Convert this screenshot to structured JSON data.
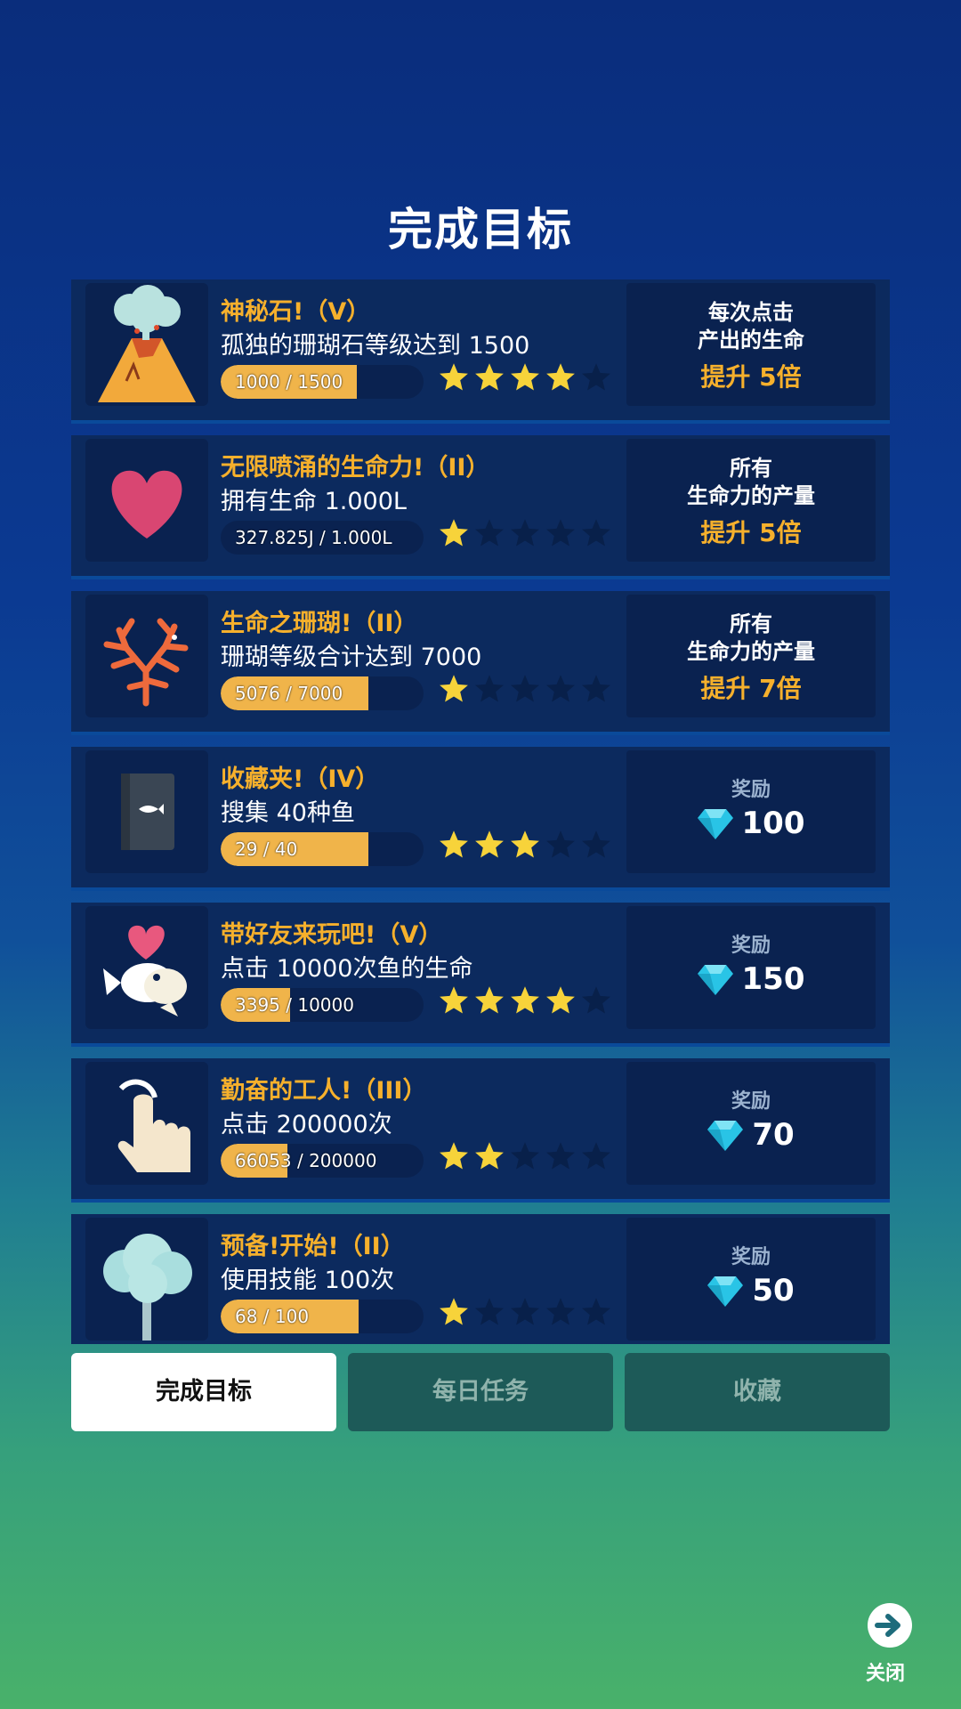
{
  "page": {
    "title": "完成目标"
  },
  "achievements": [
    {
      "name": "神秘石!（V）",
      "desc": "孤独的珊瑚石等级达到 1500",
      "progress_text": "1000 / 1500",
      "progress": 0.667,
      "stars": 4,
      "reward": {
        "type": "boost",
        "line1": "每次点击",
        "line2": "产出的生命",
        "boost": "提升 5倍"
      },
      "icon": "volcano-icon"
    },
    {
      "name": "无限喷涌的生命力!（II）",
      "desc": "拥有生命 1.000L",
      "progress_text": "327.825J / 1.000L",
      "progress": 0.0,
      "stars": 1,
      "reward": {
        "type": "boost",
        "line1": "所有",
        "line2": "生命力的产量",
        "boost": "提升 5倍"
      },
      "icon": "heart-icon"
    },
    {
      "name": "生命之珊瑚!（II）",
      "desc": "珊瑚等级合计达到 7000",
      "progress_text": "5076 / 7000",
      "progress": 0.725,
      "stars": 1,
      "reward": {
        "type": "boost",
        "line1": "所有",
        "line2": "生命力的产量",
        "boost": "提升 7倍"
      },
      "icon": "coral-icon"
    },
    {
      "name": "收藏夹!（IV）",
      "desc": "搜集 40种鱼",
      "progress_text": "29 / 40",
      "progress": 0.725,
      "stars": 3,
      "reward": {
        "type": "gem",
        "label": "奖励",
        "value": "100"
      },
      "icon": "book-icon"
    },
    {
      "name": "带好友来玩吧!（V）",
      "desc": "点击 10000次鱼的生命",
      "progress_text": "3395 / 10000",
      "progress": 0.34,
      "stars": 4,
      "reward": {
        "type": "gem",
        "label": "奖励",
        "value": "150"
      },
      "icon": "fish-heart-icon"
    },
    {
      "name": "勤奋的工人!（III）",
      "desc": "点击 200000次",
      "progress_text": "66053 / 200000",
      "progress": 0.33,
      "stars": 2,
      "reward": {
        "type": "gem",
        "label": "奖励",
        "value": "70"
      },
      "icon": "tap-hand-icon"
    },
    {
      "name": "预备!开始!（II）",
      "desc": "使用技能 100次",
      "progress_text": "68 / 100",
      "progress": 0.68,
      "stars": 1,
      "reward": {
        "type": "gem",
        "label": "奖励",
        "value": "50"
      },
      "icon": "tree-icon"
    }
  ],
  "tabs": [
    {
      "label": "完成目标",
      "active": true
    },
    {
      "label": "每日任务",
      "active": false
    },
    {
      "label": "收藏",
      "active": false
    }
  ],
  "close": {
    "label": "关闭",
    "icon": "arrow-right-circle-icon"
  },
  "colors": {
    "accent": "#f6b02c",
    "bar_fill": "#f0b44a",
    "gem": "#29c4e6"
  }
}
